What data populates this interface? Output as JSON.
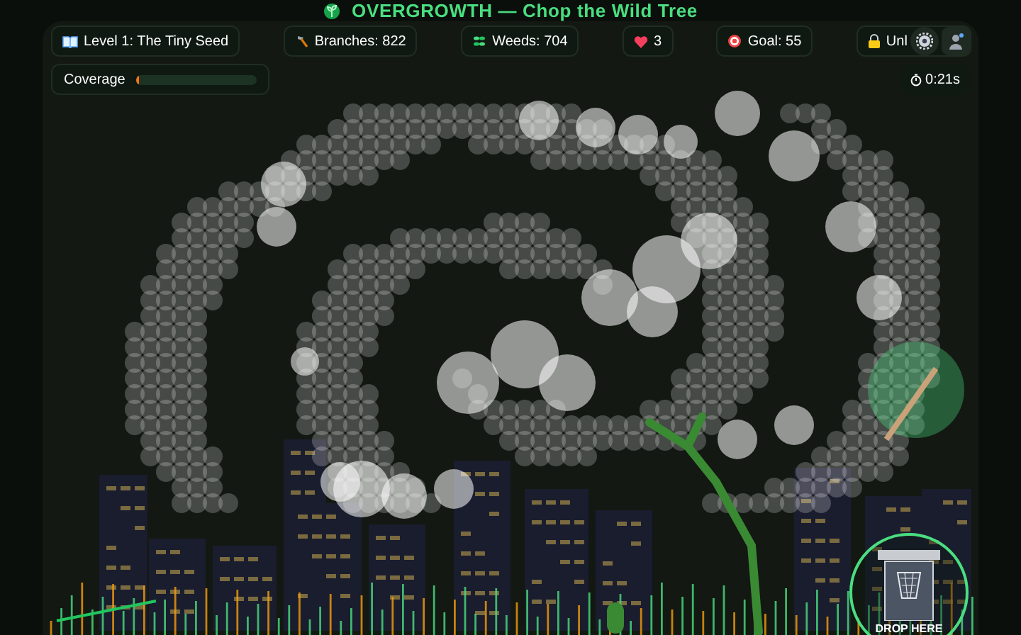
{
  "title": "OVERGROWTH — Chop the Wild Tree",
  "hud": [
    {
      "kind": "level",
      "text": "Level 1: The Tiny Seed"
    },
    {
      "kind": "branches",
      "text": "Branches: 822"
    },
    {
      "kind": "weeds",
      "text": "Weeds: 704"
    },
    {
      "kind": "lives",
      "text": "3"
    },
    {
      "kind": "goal",
      "text": "Goal: 55"
    },
    {
      "kind": "unlock",
      "text": "Unl"
    }
  ],
  "coverage": {
    "label": "Coverage",
    "level": 0.01
  },
  "timer": "0:21s",
  "drop_zone": {
    "label": "DROP HERE"
  }
}
